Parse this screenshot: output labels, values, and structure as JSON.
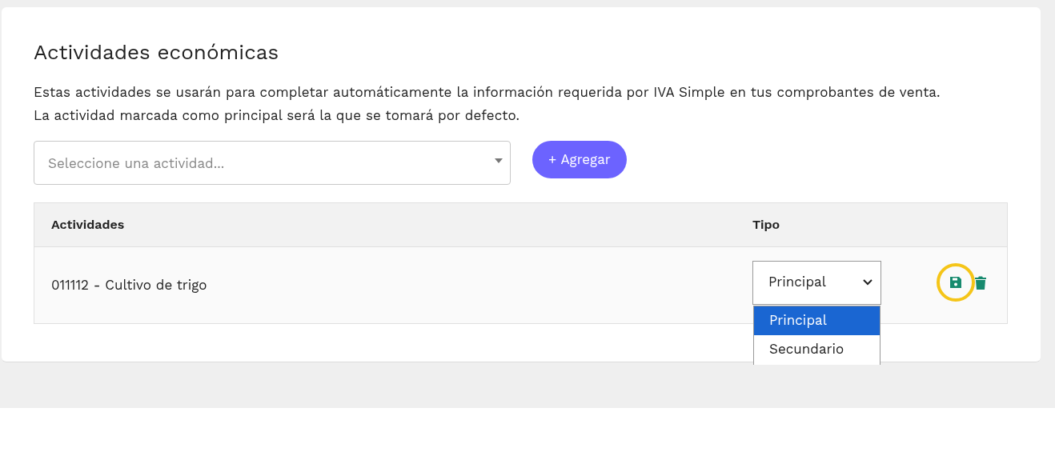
{
  "title": "Actividades económicas",
  "description": "Estas actividades se usarán para completar automáticamente la información requerida por IVA Simple en tus comprobantes de venta. La actividad marcada como principal será la que se tomará por defecto.",
  "activity_select": {
    "placeholder": "Seleccione una actividad..."
  },
  "add_button": "+ Agregar",
  "table": {
    "columns": [
      "Actividades",
      "Tipo"
    ],
    "rows": [
      {
        "activity": "011112 - Cultivo de trigo",
        "type": "Principal",
        "save_highlighted": true,
        "type_options": [
          {
            "label": "Principal",
            "selected": true
          },
          {
            "label": "Secundario",
            "selected": false
          }
        ]
      }
    ]
  }
}
